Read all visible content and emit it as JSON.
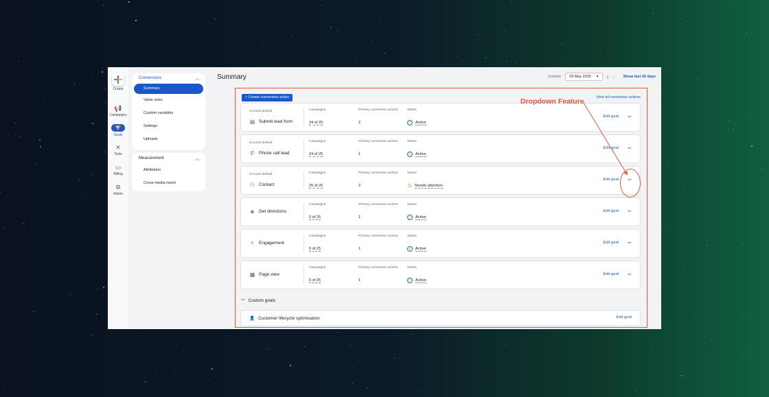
{
  "rail": {
    "create": "Create",
    "campaigns": "Campaigns",
    "goals": "Goals",
    "tools": "Tools",
    "billing": "Billing",
    "admin": "Admin"
  },
  "nav": {
    "conversions": "Conversions",
    "summary": "Summary",
    "value_rules": "Value rules",
    "custom_variables": "Custom variables",
    "settings": "Settings",
    "uploads": "Uploads",
    "measurement": "Measurement",
    "attribution": "Attribution",
    "cross_media": "Cross-media reach"
  },
  "header": {
    "title": "Summary",
    "range_label": "Custom",
    "date": "29 May 2025",
    "show_last": "Show last 30 days"
  },
  "panel": {
    "create_button": "Create conversion action",
    "view_all": "View all conversion actions"
  },
  "labels": {
    "account_default": "Account default",
    "campaigns": "Campaigns",
    "primary": "Primary conversion actions",
    "status": "Status",
    "edit_goal": "Edit goal"
  },
  "goals": [
    {
      "name": "Submit lead form",
      "icon": "form-icon",
      "account_default": true,
      "campaigns": "24 of 25",
      "primary": "2",
      "status": "Active"
    },
    {
      "name": "Phone call lead",
      "icon": "phone-icon",
      "account_default": true,
      "campaigns": "24 of 25",
      "primary": "1",
      "status": "Active"
    },
    {
      "name": "Contact",
      "icon": "people-icon",
      "account_default": true,
      "campaigns": "25 of 25",
      "primary": "2",
      "status": "Needs attention"
    },
    {
      "name": "Get directions",
      "icon": "directions-icon",
      "account_default": false,
      "campaigns": "0 of 25",
      "primary": "1",
      "status": "Active"
    },
    {
      "name": "Engagement",
      "icon": "click-icon",
      "account_default": false,
      "campaigns": "0 of 25",
      "primary": "1",
      "status": "Active"
    },
    {
      "name": "Page view",
      "icon": "page-icon",
      "account_default": false,
      "campaigns": "0 of 25",
      "primary": "1",
      "status": "Active"
    }
  ],
  "custom": {
    "heading": "Custom goals",
    "item": "Customer lifecycle optimisation",
    "edit": "Edit goal"
  },
  "annotation": {
    "label": "Dropdown Feature",
    "color": "#e8533f"
  },
  "colors": {
    "accent": "#1a57c9",
    "active": "#188038",
    "warning": "#e37400"
  }
}
